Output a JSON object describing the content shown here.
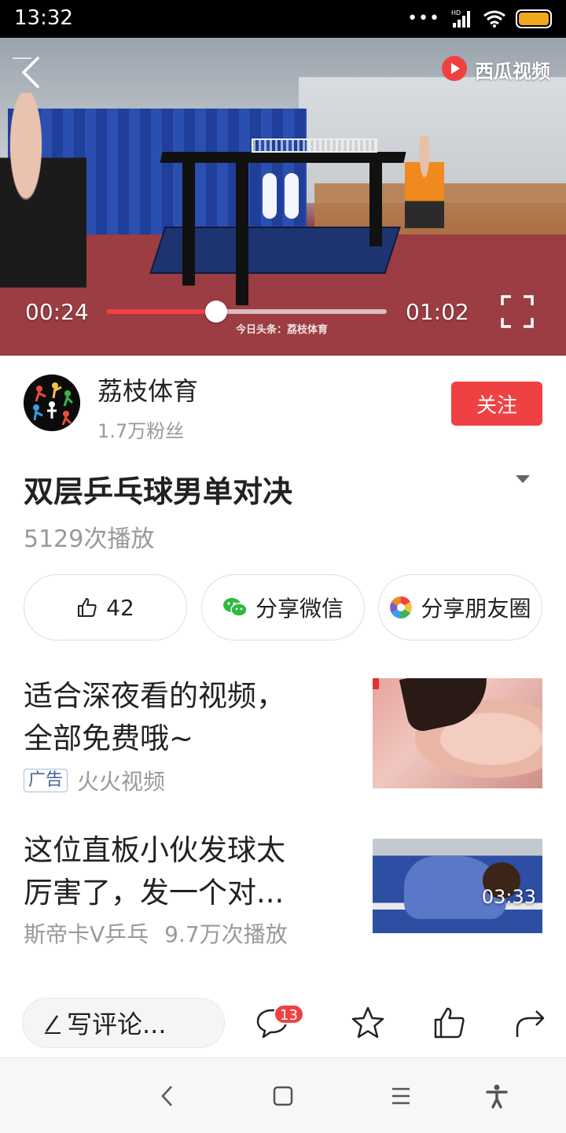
{
  "status_bar": {
    "time": "13:32",
    "signal_label": "HD",
    "battery_color": "#f2a81d"
  },
  "player": {
    "brand_name": "西瓜视频",
    "current_time": "00:24",
    "total_time": "01:02",
    "progress": 0.39,
    "watermark": "今日头条：荔枝体育",
    "state": "playing",
    "accent_color": "#f04142"
  },
  "author": {
    "name": "荔枝体育",
    "fans": "1.7万粉丝",
    "follow_label": "关注"
  },
  "video": {
    "title": "双层乒乓球男单对决",
    "play_count": "5129次播放"
  },
  "actions": {
    "like_count": "42",
    "share_wechat": "分享微信",
    "share_moments": "分享朋友圈"
  },
  "feed": [
    {
      "title_line1": "适合深夜看的视频，",
      "title_line2": "全部免费哦~",
      "badge": "广告",
      "source": "火火视频"
    },
    {
      "title_line1": "这位直板小伙发球太",
      "title_line2": "厉害了，发一个对...",
      "source": "斯帝卡V乒乓",
      "views": "9.7万次播放",
      "duration": "03:33"
    }
  ],
  "bottom_bar": {
    "comment_placeholder": "写评论...",
    "comment_count": "13"
  },
  "icons": {
    "back": "back-arrow-icon",
    "pause": "pause-icon",
    "fullscreen": "fullscreen-icon",
    "like": "thumbs-up-icon",
    "wechat": "wechat-icon",
    "moments": "moments-icon",
    "comment": "comment-bubble-icon",
    "favorite": "star-icon",
    "share": "share-arrow-icon"
  }
}
